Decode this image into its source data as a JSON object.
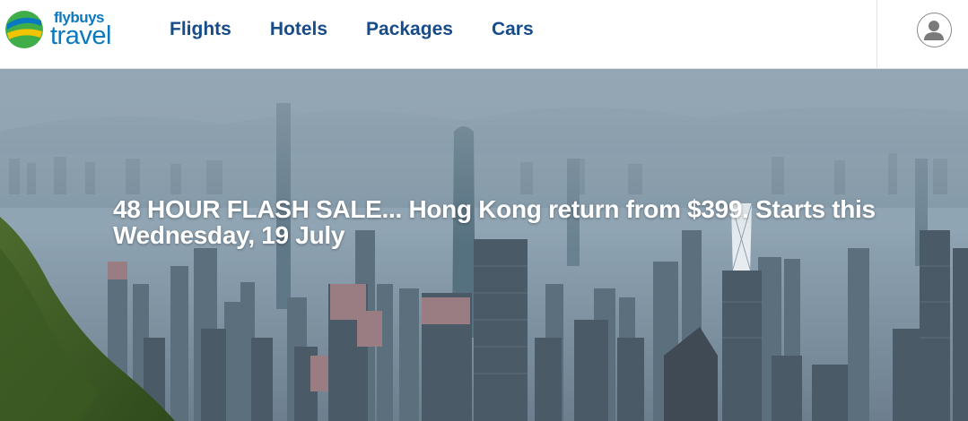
{
  "brand": {
    "line1": "flybuys",
    "line2": "travel",
    "colors": {
      "blue": "#0b79bf",
      "green": "#3fae49",
      "yellow": "#f2c400",
      "navy": "#174c8a"
    }
  },
  "nav": {
    "items": [
      {
        "label": "Flights"
      },
      {
        "label": "Hotels"
      },
      {
        "label": "Packages"
      },
      {
        "label": "Cars"
      }
    ]
  },
  "account": {
    "icon": "user-icon"
  },
  "hero": {
    "headline": "48 HOUR FLASH SALE... Hong Kong return from $399. Starts this Wednesday, 19 July",
    "image": "hong-kong-skyline"
  }
}
